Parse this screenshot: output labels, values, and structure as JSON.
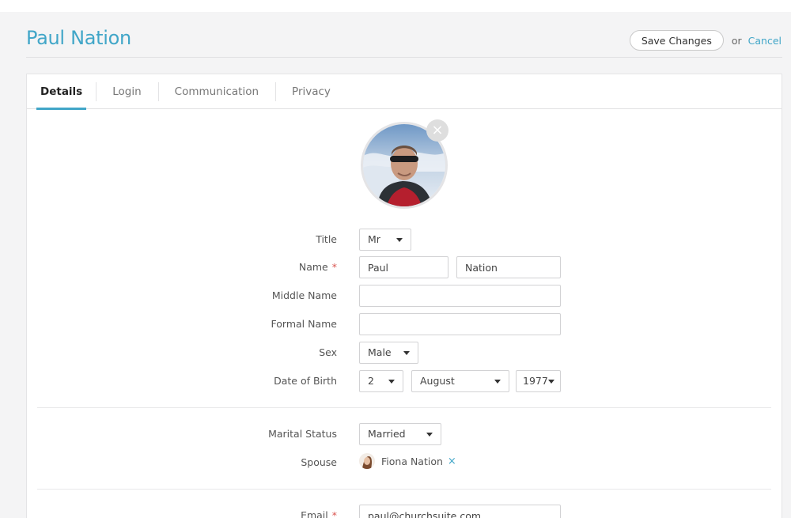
{
  "header": {
    "title": "Paul Nation",
    "save_label": "Save Changes",
    "or_text": "or",
    "cancel_label": "Cancel"
  },
  "tabs": [
    {
      "label": "Details",
      "active": true
    },
    {
      "label": "Login",
      "active": false
    },
    {
      "label": "Communication",
      "active": false
    },
    {
      "label": "Privacy",
      "active": false
    }
  ],
  "avatar": {
    "remove_icon": "×"
  },
  "form": {
    "title": {
      "label": "Title",
      "value": "Mr"
    },
    "name": {
      "label": "Name",
      "required_mark": "*",
      "first": "Paul",
      "last": "Nation"
    },
    "middle_name": {
      "label": "Middle Name",
      "value": ""
    },
    "formal_name": {
      "label": "Formal Name",
      "value": ""
    },
    "sex": {
      "label": "Sex",
      "value": "Male"
    },
    "dob": {
      "label": "Date of Birth",
      "day": "2",
      "month": "August",
      "year": "1977"
    },
    "marital_status": {
      "label": "Marital Status",
      "value": "Married"
    },
    "spouse": {
      "label": "Spouse",
      "name": "Fiona Nation",
      "remove_icon": "×"
    },
    "email": {
      "label": "Email",
      "required_mark": "*",
      "value": "paul@churchsuite.com"
    }
  },
  "colors": {
    "accent": "#41a6c8",
    "required": "#d9534f"
  }
}
